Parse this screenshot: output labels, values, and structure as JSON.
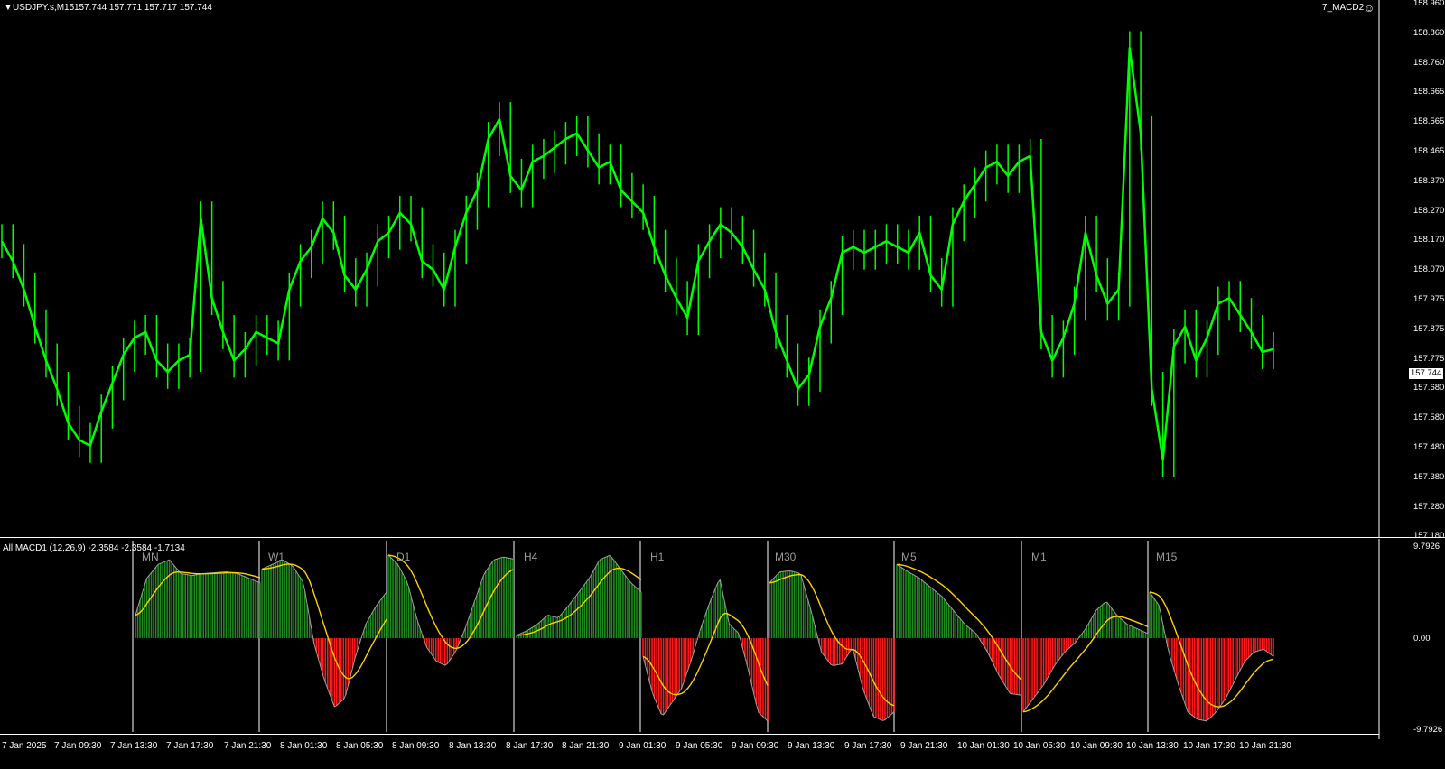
{
  "chart_header": {
    "symbol": "USDJPY.s,M15",
    "ohlc": "157.744 157.771 157.717 157.744",
    "indicator_short": "7_MACD2"
  },
  "price_axis": {
    "ticks": [
      "158.960",
      "158.860",
      "158.760",
      "158.665",
      "158.565",
      "158.465",
      "158.370",
      "158.270",
      "158.170",
      "158.070",
      "157.975",
      "157.875",
      "157.775",
      "157.680",
      "157.580",
      "157.480",
      "157.380",
      "157.280",
      "157.180"
    ],
    "current_price": "157.744"
  },
  "indicator_header": {
    "label": "All MACD1 (12,26,9) -2.3584 -2.3584 -1.7134"
  },
  "indicator_axis": {
    "top": "9.7926",
    "zero": "0.00",
    "bottom": "-9.7926"
  },
  "timeframes": [
    "MN",
    "W1",
    "D1",
    "H4",
    "H1",
    "M30",
    "M5",
    "M1",
    "M15"
  ],
  "time_axis": [
    "7 Jan 2025",
    "7 Jan 09:30",
    "7 Jan 13:30",
    "7 Jan 17:30",
    "7 Jan 21:30",
    "8 Jan 01:30",
    "8 Jan 05:30",
    "8 Jan 09:30",
    "8 Jan 13:30",
    "8 Jan 17:30",
    "8 Jan 21:30",
    "9 Jan 01:30",
    "9 Jan 05:30",
    "9 Jan 09:30",
    "9 Jan 13:30",
    "9 Jan 17:30",
    "9 Jan 21:30",
    "10 Jan 01:30",
    "10 Jan 05:30",
    "10 Jan 09:30",
    "10 Jan 13:30",
    "10 Jan 17:30",
    "10 Jan 21:30"
  ],
  "colors": {
    "background": "#000000",
    "price_bars": "#00ff00",
    "histogram_positive": "#1f8a1f",
    "histogram_negative": "#ff1a1a",
    "macd_line": "#a0a0a0",
    "signal_line": "#ffd000",
    "separator": "#808080"
  },
  "chart_data": [
    {
      "type": "line",
      "title": "USDJPY.s,M15",
      "series": [
        {
          "name": "USDJPY.s,M15",
          "values": [
            158.12,
            158.05,
            157.95,
            157.82,
            157.7,
            157.6,
            157.48,
            157.42,
            157.4,
            157.52,
            157.62,
            157.72,
            157.78,
            157.8,
            157.7,
            157.66,
            157.7,
            157.72,
            158.2,
            157.92,
            157.8,
            157.7,
            157.74,
            157.8,
            157.78,
            157.76,
            157.95,
            158.05,
            158.1,
            158.2,
            158.15,
            158.0,
            157.95,
            158.02,
            158.12,
            158.15,
            158.22,
            158.18,
            158.05,
            158.02,
            157.95,
            158.1,
            158.22,
            158.3,
            158.48,
            158.55,
            158.35,
            158.3,
            158.4,
            158.42,
            158.45,
            158.48,
            158.5,
            158.44,
            158.38,
            158.4,
            158.3,
            158.26,
            158.22,
            158.1,
            158.0,
            157.92,
            157.85,
            158.05,
            158.12,
            158.18,
            158.15,
            158.1,
            158.02,
            157.95,
            157.8,
            157.7,
            157.6,
            157.65,
            157.82,
            157.92,
            158.08,
            158.1,
            158.08,
            158.1,
            158.12,
            158.1,
            158.08,
            158.15,
            158.0,
            157.95,
            158.18,
            158.26,
            158.32,
            158.38,
            158.4,
            158.35,
            158.4,
            158.42,
            157.8,
            157.7,
            157.78,
            157.9,
            158.15,
            158.0,
            157.9,
            157.95,
            158.8,
            158.5,
            157.6,
            157.35,
            157.75,
            157.82,
            157.7,
            157.78,
            157.9,
            157.92,
            157.86,
            157.8,
            157.73,
            157.74
          ]
        }
      ],
      "ylim": [
        157.18,
        158.96
      ]
    },
    {
      "type": "bar",
      "title": "All MACD1 (12,26,9) -2.3584 -2.3584 -1.7134",
      "categories": [
        "MN",
        "W1",
        "D1",
        "H4",
        "H1",
        "M30",
        "M5",
        "M1",
        "M15"
      ],
      "series": [
        {
          "name": "MN",
          "values": [
            2.5,
            6.5,
            8.0,
            8.5,
            7.0,
            6.8,
            7.0,
            7.1,
            7.2,
            7.0,
            6.5,
            6.0
          ]
        },
        {
          "name": "W1",
          "values": [
            7.5,
            8.0,
            8.5,
            7.8,
            6.0,
            -0.5,
            -4.5,
            -7.5,
            -6.5,
            -2.0,
            1.5,
            3.5,
            5.0
          ]
        },
        {
          "name": "D1",
          "values": [
            9.0,
            8.0,
            6.0,
            2.0,
            -1.0,
            -2.5,
            -3.0,
            -1.5,
            1.0,
            4.0,
            7.0,
            8.5,
            8.8,
            8.6
          ]
        },
        {
          "name": "H4",
          "values": [
            0.3,
            0.8,
            1.5,
            2.5,
            2.2,
            3.5,
            5.0,
            6.5,
            8.5,
            9.0,
            7.5,
            6.0,
            5.0
          ]
        },
        {
          "name": "H1",
          "values": [
            -2.0,
            -6.0,
            -8.5,
            -7.0,
            -5.5,
            -2.5,
            1.0,
            4.0,
            6.5,
            1.5,
            0.5,
            -3.5,
            -8.0,
            -9.0
          ]
        },
        {
          "name": "M30",
          "values": [
            6.0,
            7.2,
            7.3,
            7.0,
            3.0,
            -1.5,
            -3.0,
            -2.8,
            -1.0,
            -5.5,
            -8.5,
            -9.0,
            -8.0
          ]
        },
        {
          "name": "M5",
          "values": [
            8.0,
            7.2,
            6.5,
            5.5,
            4.5,
            3.0,
            1.5,
            0.5,
            -1.5,
            -4.0,
            -6.0,
            -6.2
          ]
        },
        {
          "name": "M1",
          "values": [
            -8.0,
            -6.5,
            -5.0,
            -3.0,
            -1.5,
            -0.5,
            1.0,
            3.0,
            4.0,
            2.5,
            1.5,
            1.0,
            0.5
          ]
        },
        {
          "name": "M15",
          "values": [
            5.0,
            3.5,
            -1.5,
            -5.0,
            -8.0,
            -8.8,
            -9.0,
            -8.0,
            -6.5,
            -4.5,
            -2.5,
            -1.5,
            -1.2,
            -2.0
          ]
        }
      ],
      "ylim": [
        -9.7926,
        9.7926
      ]
    }
  ]
}
